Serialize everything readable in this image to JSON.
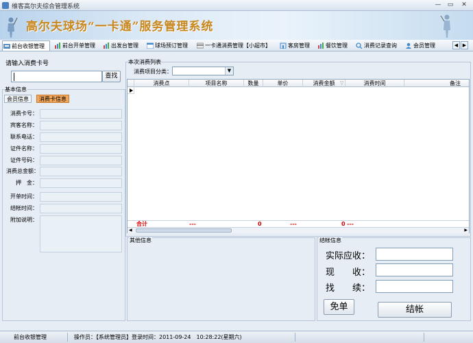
{
  "window": {
    "title": "维客高尔夫综合管理系统"
  },
  "banner": {
    "title": "高尔夫球场“一卡通”服务管理系统"
  },
  "toolbar": {
    "tabs": [
      {
        "label": "前台收银管理"
      },
      {
        "label": "前台开单管理"
      },
      {
        "label": "出发台管理"
      },
      {
        "label": "球场预订管理"
      },
      {
        "label": "一卡通消费管理【小超市】"
      },
      {
        "label": "客房管理"
      },
      {
        "label": "餐饮管理"
      },
      {
        "label": "消费记录查询"
      },
      {
        "label": "会员管理"
      }
    ],
    "active_tab": "前台收银管理"
  },
  "left": {
    "card_label": "请输入消费卡号",
    "card_value": "",
    "search_button": "查找",
    "basic_info_title": "基本信息",
    "sub_tabs": [
      {
        "label": "会员信息"
      },
      {
        "label": "消费卡信息"
      }
    ],
    "fields": [
      {
        "label": "消费卡号："
      },
      {
        "label": "宾客名称："
      },
      {
        "label": "联系电话："
      },
      {
        "label": "证件名称："
      },
      {
        "label": "证件号码："
      },
      {
        "label": "消费总金额："
      },
      {
        "label": "押　金："
      },
      {
        "label": "开单时间："
      },
      {
        "label": "结帐时间："
      },
      {
        "label": "附加说明："
      }
    ]
  },
  "main": {
    "section_title": "本次消费列表",
    "category_label": "消费项目分类：",
    "category_value": "",
    "columns": [
      "消费点",
      "项目名称",
      "数量",
      "单价",
      "消费金额",
      "消费时间",
      "备注"
    ],
    "total": {
      "label": "合计",
      "dash1": "---",
      "qty": "0",
      "dash2": "---",
      "amount": "0",
      "dash3": "---"
    }
  },
  "other": {
    "title": "其他信息"
  },
  "settle": {
    "title": "结帐信息",
    "labels": [
      "实际应收：",
      "现　　收：",
      "找　　续："
    ],
    "free_button": "免单",
    "checkout_button": "结帐"
  },
  "status": {
    "module": "前台收银管理",
    "operator": "操作员：【系统管理员】登录时间：2011-09-24　10:28:22(星期六)"
  }
}
